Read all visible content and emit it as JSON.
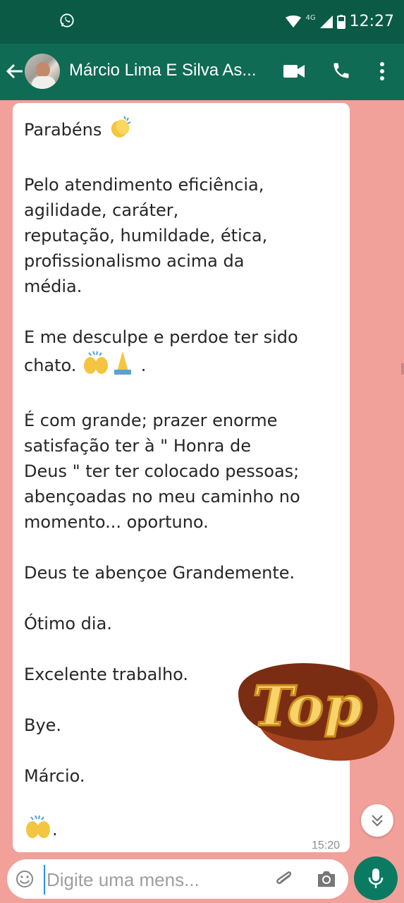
{
  "status_bar": {
    "network": "4G",
    "time": "12:27"
  },
  "header": {
    "contact_name": "Márcio Lima E Silva As..."
  },
  "message": {
    "paragraphs": [
      "Parabéns",
      "Pelo atendimento eficiência,\nagilidade, caráter,\nreputação, humildade, ética,\nprofissionalismo acima da\nmédia.",
      "E me desculpe e perdoe ter sido\nchato.",
      "É com grande; prazer enorme\nsatisfação ter à \" Honra de\nDeus \" ter ter colocado pessoas;\nabençoadas no meu caminho no\nmomento... oportuno.",
      "Deus te abençoe Grandemente.",
      "Ótimo dia.",
      "Excelente trabalho.",
      "Bye.",
      "Márcio.",
      "."
    ],
    "chato_suffix": " .",
    "time": "15:20"
  },
  "sticker": {
    "text": "Top"
  },
  "input": {
    "placeholder": "Digite uma mens..."
  },
  "icons": {
    "whatsapp": "whatsapp-icon",
    "back": "back-arrow-icon",
    "video": "video-call-icon",
    "call": "phone-icon",
    "menu": "more-vert-icon",
    "emoji": "emoji-icon",
    "attach": "attach-icon",
    "camera": "camera-icon",
    "mic": "mic-icon",
    "scroll": "chevron-double-down-icon"
  },
  "colors": {
    "header": "#0f6b54",
    "status_bar": "#0b5a46",
    "chat_bg": "#f2a09a",
    "mic_button": "#0b7a63"
  }
}
